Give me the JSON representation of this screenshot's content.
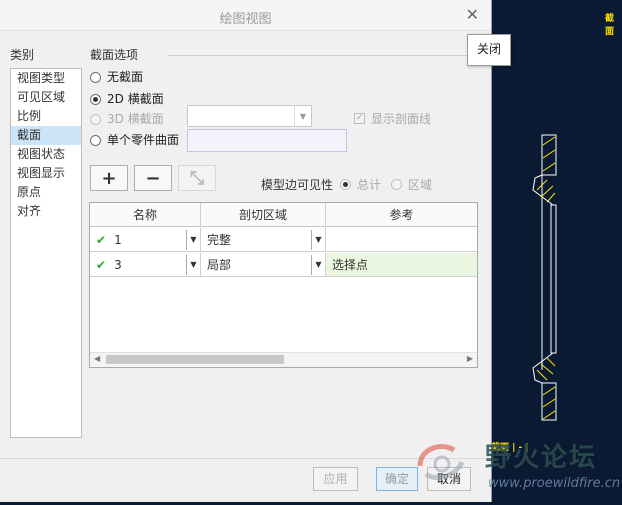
{
  "dialog": {
    "title": "绘图视图",
    "close_glyph": "✕"
  },
  "tooltip": "关闭",
  "categories": {
    "label": "类别",
    "items": [
      "视图类型",
      "可见区域",
      "比例",
      "截面",
      "视图状态",
      "视图显示",
      "原点",
      "对齐"
    ],
    "selected_index": 3
  },
  "section_options": {
    "title": "截面选项",
    "radios": [
      {
        "label": "无截面",
        "checked": false,
        "disabled": false
      },
      {
        "label": "2D 横截面",
        "checked": true,
        "disabled": false
      },
      {
        "label": "3D 横截面",
        "checked": false,
        "disabled": true
      },
      {
        "label": "单个零件曲面",
        "checked": false,
        "disabled": false
      }
    ],
    "show_hatch_label": "显示剖面线",
    "show_hatch_checked": true
  },
  "toolbar": {
    "add_glyph": "+",
    "remove_glyph": "−",
    "flip_glyph": "⤡",
    "visibility_label": "模型边可见性",
    "vis_total": "总计",
    "vis_region": "区域"
  },
  "table": {
    "headers": [
      "名称",
      "剖切区域",
      "参考"
    ],
    "rows": [
      {
        "name": "1",
        "region": "完整",
        "reference": "",
        "highlight": false
      },
      {
        "name": "3",
        "region": "局部",
        "reference": "选择点",
        "highlight": true
      }
    ],
    "check_glyph": "✔"
  },
  "buttons": {
    "apply": "应用",
    "ok": "确定",
    "cancel": "取消"
  },
  "cad_view": {
    "top_label": "截面",
    "bottom_label": "截面  | - |"
  },
  "watermark": {
    "text": "野火论坛",
    "url": "www.proewildfire.cn"
  },
  "colors": {
    "dialog_bg": "#f0f0f0",
    "cad_bg": "#0a1a33",
    "cad_lines": "#ffffff",
    "cad_hatch": "#ffe600",
    "selection": "#cce4f7",
    "check_green": "#2fa82f"
  }
}
